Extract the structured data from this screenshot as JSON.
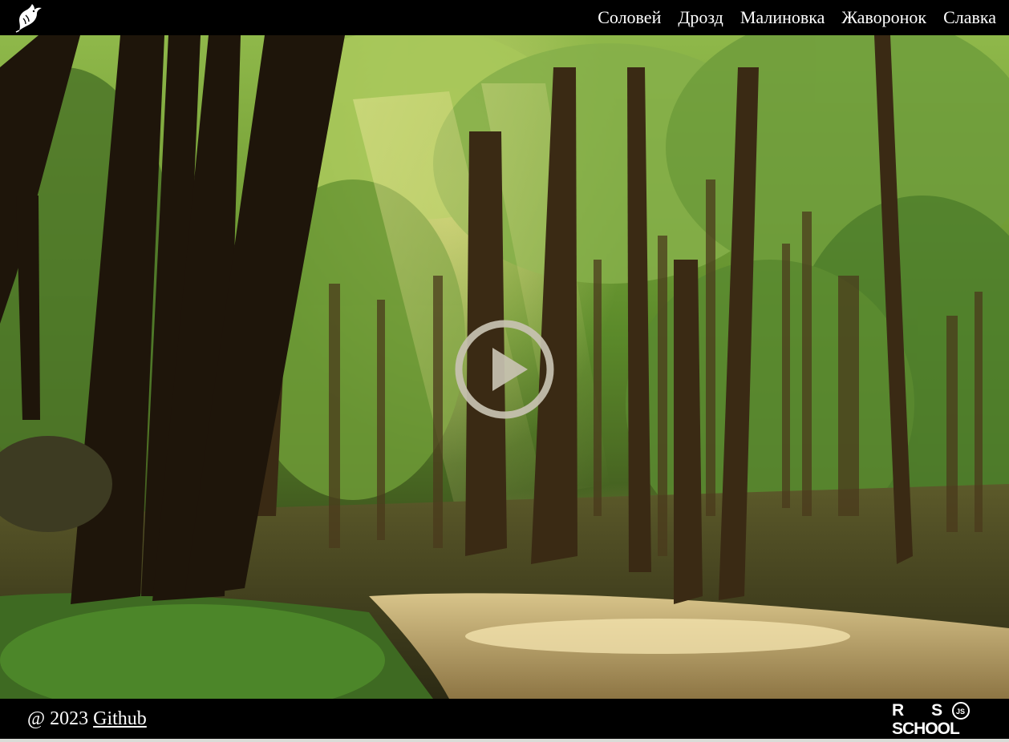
{
  "header": {
    "logo_icon": "bird-logo-icon",
    "nav": [
      {
        "label": "Соловей"
      },
      {
        "label": "Дрозд"
      },
      {
        "label": "Малиновка"
      },
      {
        "label": "Жаворонок"
      },
      {
        "label": "Славка"
      }
    ]
  },
  "player": {
    "play_icon": "play-icon"
  },
  "footer": {
    "copyright_prefix": "@ 2023",
    "github_link": "Github",
    "school_logo_line1": "RS",
    "school_logo_line2": "SCHOOL",
    "school_logo_badge": "JS"
  },
  "colors": {
    "header_bg": "#000000",
    "footer_bg": "#000000",
    "nav_text": "#ffffff",
    "play_button": "#c8c2b2"
  }
}
